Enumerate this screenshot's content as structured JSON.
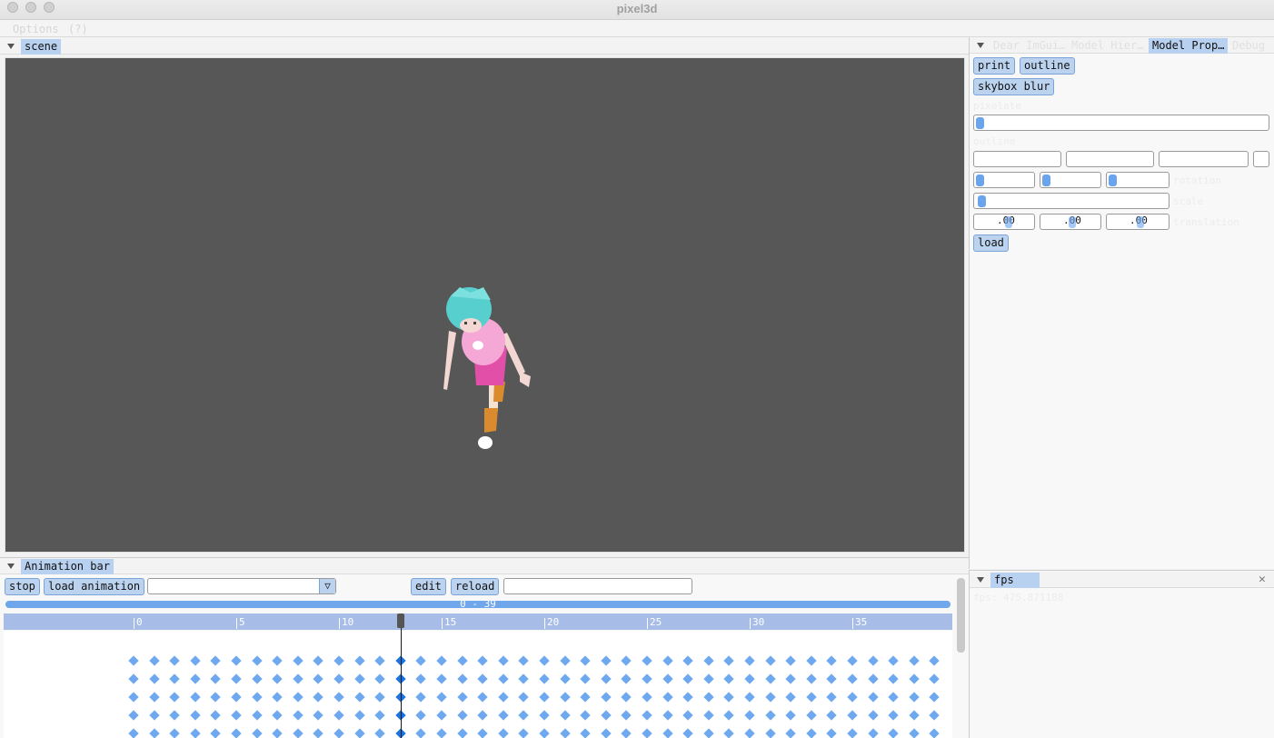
{
  "window": {
    "title": "pixel3d"
  },
  "menu": {
    "items": [
      "Options",
      "(?)"
    ]
  },
  "scene_panel": {
    "tab": "scene"
  },
  "right_panel": {
    "tabs": [
      "Dear ImGui…",
      "Model Hier…",
      "Model Prop…",
      "Debug"
    ],
    "active_tab": "Model Prop…",
    "buttons": {
      "print": "print",
      "outline": "outline",
      "skybox_blur": "skybox blur",
      "load": "load"
    },
    "labels": {
      "pixelate": "pixelate",
      "outline": "outline",
      "rotation": "rotation",
      "scale": "scale",
      "translation": "translation"
    },
    "translation_values": [
      ".00",
      ".00",
      ".00"
    ]
  },
  "animation_panel": {
    "tab": "Animation bar",
    "buttons": {
      "stop": "stop",
      "load_animation": "load animation",
      "edit": "edit",
      "reload": "reload"
    },
    "range_text": "0 - 39",
    "ticks": [
      "0",
      "5",
      "10",
      "15",
      "20",
      "25",
      "30",
      "35"
    ],
    "current_frame": 13,
    "frame_count": 40,
    "track_rows": 5
  },
  "fps_panel": {
    "tab": "fps",
    "text": "fps: 475.871188"
  }
}
